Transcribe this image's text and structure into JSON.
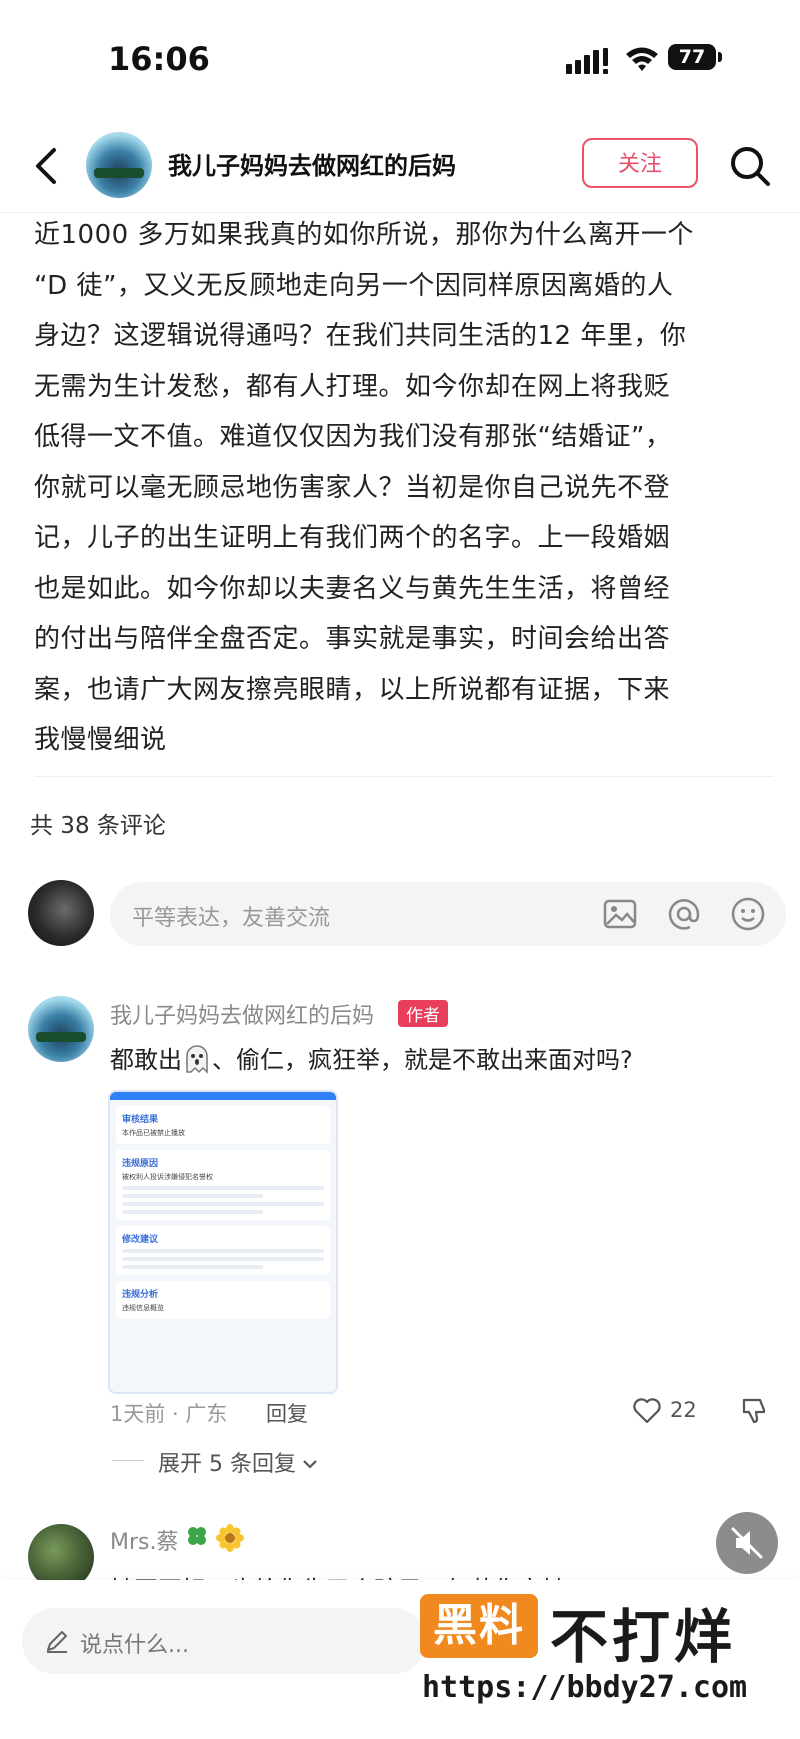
{
  "status_bar": {
    "time": "16:06",
    "battery": "77"
  },
  "nav": {
    "title": "我儿子妈妈去做网红的后妈",
    "follow_label": "关注"
  },
  "post": {
    "lines": [
      "近1000 多万如果我真的如你所说，那你为什么离开一个",
      "“D 徒”，又义无反顾地走向另一个因同样原因离婚的人",
      "身边？这逻辑说得通吗？在我们共同生活的12 年里，你",
      "无需为生计发愁，都有人打理。如今你却在网上将我贬",
      "低得一文不值。难道仅仅因为我们没有那张“结婚证”，",
      "你就可以毫无顾忌地伤害家人？当初是你自己说先不登",
      "记，儿子的出生证明上有我们两个的名字。上一段婚姻",
      "也是如此。如今你却以夫妻名义与黄先生生活，将曾经",
      "的付出与陪伴全盘否定。事实就是事实，时间会给出答",
      "案，也请广大网友擦亮眼睛，以上所说都有证据，下来",
      "我慢慢细说"
    ]
  },
  "comments_header": {
    "count_label": "共 38 条评论"
  },
  "comment_input": {
    "placeholder": "平等表达，友善交流"
  },
  "comment1": {
    "name": "我儿子妈妈去做网红的后妈",
    "tag": "作者",
    "text_before": "都敢出",
    "text_after": "、偷仁，疯狂举，就是不敢出来面对吗?",
    "meta": "1天前 · 广东",
    "reply_label": "回复",
    "likes": "22",
    "expand_label": "展开 5 条回复",
    "screenshot": {
      "card1_title": "审核结果",
      "card1_line": "本作品已被禁止播放",
      "card2_title": "违规原因",
      "card2_line": "被权利人投诉涉嫌侵犯名誉权",
      "card3_title": "修改建议",
      "card4_title": "违规分析",
      "card4_line": "违规信息概览"
    }
  },
  "comment2": {
    "name": "Mrs.蔡",
    "text": "她再不好，也给你生了个孩子，何苦伤害她"
  },
  "bottom": {
    "placeholder": "说点什么..."
  },
  "watermark": {
    "box_text": "黑料",
    "main_text": "不打烊",
    "url": "https://bbdy27.com"
  }
}
